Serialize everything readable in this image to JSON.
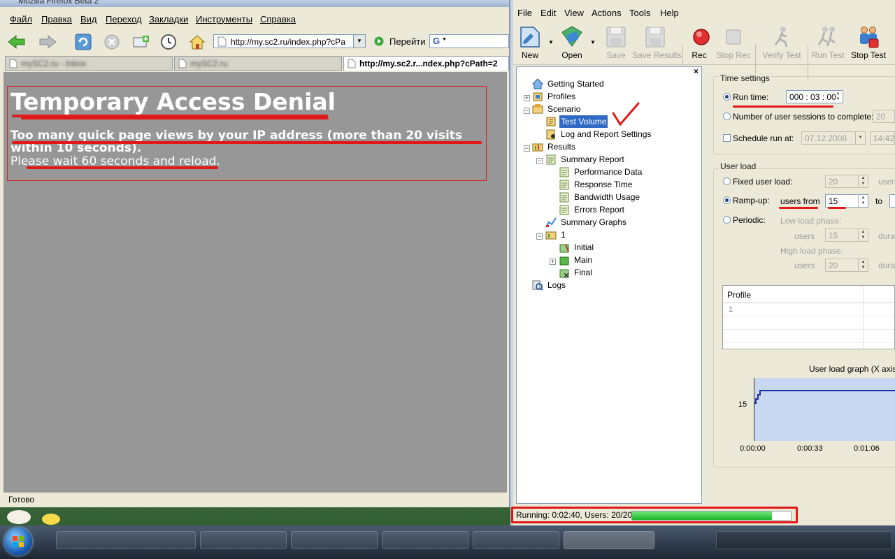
{
  "firefox": {
    "title": "Mozilla Firefox Beta 2",
    "menu": [
      "Файл",
      "Правка",
      "Вид",
      "Переход",
      "Закладки",
      "Инструменты",
      "Справка"
    ],
    "url": "http://my.sc2.ru/index.php?cPa",
    "go_label": "Перейти",
    "tabs": [
      "mySC2.ru - Inbox",
      "mySC2.ru",
      "http://my.sc2.r...ndex.php?cPath=2"
    ],
    "page": {
      "title": "Temporary Access Denial",
      "message": "Too many quick page views by your IP address (more than 20 visits within 10 seconds).",
      "wait": "Please wait 60 seconds and reload."
    },
    "status": "Готово"
  },
  "app": {
    "menu": [
      "File",
      "Edit",
      "View",
      "Actions",
      "Tools",
      "Help"
    ],
    "toolbar": {
      "new": "New",
      "open": "Open",
      "save": "Save",
      "save_results": "Save Results",
      "rec": "Rec",
      "stop_rec": "Stop Rec",
      "verify_test": "Verify Test",
      "run_test": "Run Test",
      "stop_test": "Stop Test"
    },
    "tree": {
      "getting_started": "Getting Started",
      "profiles": "Profiles",
      "scenario": "Scenario",
      "test_volume": "Test Volume",
      "log_report": "Log and Report Settings",
      "results": "Results",
      "summary_report": "Summary Report",
      "performance_data": "Performance Data",
      "response_time": "Response Time",
      "bandwidth_usage": "Bandwidth Usage",
      "errors_report": "Errors Report",
      "summary_graphs": "Summary Graphs",
      "run1": "1",
      "initial": "Initial",
      "main": "Main",
      "final": "Final",
      "logs": "Logs"
    },
    "time_settings": {
      "heading": "Time settings",
      "run_time_label": "Run time:",
      "run_time_value": "000 : 03 : 00",
      "sessions_label": "Number of user sessions to complete:",
      "sessions_value": "20",
      "schedule_label": "Schedule run at:",
      "schedule_date": "07.12.2008",
      "schedule_time": "14:42:"
    },
    "user_load": {
      "heading": "User load",
      "fixed_label": "Fixed user load:",
      "fixed_value": "20",
      "fixed_unit": "user",
      "rampup_label": "Ramp-up:",
      "users_from_label": "users from",
      "users_from_value": "15",
      "to_label": "to",
      "periodic_label": "Periodic:",
      "low_phase_label": "Low load phase:",
      "low_users_label": "users",
      "low_users_value": "15",
      "high_phase_label": "High load phase:",
      "high_users_label": "users",
      "high_users_value": "20",
      "duration_label": "dura"
    },
    "profile_table": {
      "header": "Profile",
      "rows": [
        "1"
      ]
    },
    "graph": {
      "title": "User load graph (X axis -",
      "y_tick": "15",
      "x_ticks": [
        "0:00:00",
        "0:00:33",
        "0:01:06"
      ]
    },
    "status": {
      "text": "Running: 0:02:40, Users: 20/20",
      "progress": 0.88
    }
  }
}
